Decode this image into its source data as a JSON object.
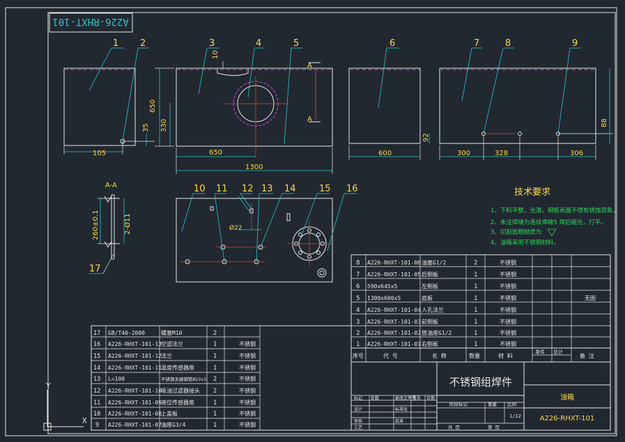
{
  "drawing_code_top": "A226-RHXT-101",
  "balloons": [
    "1",
    "2",
    "3",
    "4",
    "5",
    "6",
    "7",
    "8",
    "9",
    "10",
    "11",
    "12",
    "13",
    "14",
    "15",
    "16",
    "17"
  ],
  "dims": {
    "d10": "10",
    "d650v": "650",
    "d330": "330",
    "d35": "35",
    "d105": "105",
    "d650h": "650",
    "d1300": "1300",
    "d600": "600",
    "d92": "92",
    "d300": "300",
    "d328": "328",
    "d306": "306",
    "d88": "88",
    "d22": "Ø22",
    "d260": "260±0.1",
    "d2phi": "2-Ø11"
  },
  "section_marks": {
    "a_top": "A",
    "a_bot": "A",
    "aa": "A-A"
  },
  "tech": {
    "title": "技术要求",
    "items": [
      "1、下料平整，光滑，钢板表面不得有锈蚀现象。",
      "2、未注焊缝为连续焊缝5 焊后磨光，打平。",
      "3、切割面粗糙度为",
      "4、油箱采用不锈钢材料。"
    ]
  },
  "bom_right": [
    {
      "no": "8",
      "code": "A226-RHXT-101-06",
      "name": "油塞G1/2",
      "qty": "2",
      "mat": "不锈钢",
      "note": ""
    },
    {
      "no": "7",
      "code": "A226-RHXT-101-05",
      "name": "后侧板",
      "qty": "1",
      "mat": "不锈钢",
      "note": ""
    },
    {
      "no": "6",
      "code": "590x645x5",
      "name": "左侧板",
      "qty": "1",
      "mat": "不锈钢",
      "note": ""
    },
    {
      "no": "5",
      "code": "1300x600x5",
      "name": "底板",
      "qty": "1",
      "mat": "不锈钢",
      "note": "无图"
    },
    {
      "no": "4",
      "code": "A226-RHXT-101-04",
      "name": "人孔法兰",
      "qty": "1",
      "mat": "不锈钢",
      "note": ""
    },
    {
      "no": "3",
      "code": "A226-RHXT-101-03",
      "name": "前侧板",
      "qty": "1",
      "mat": "不锈钢",
      "note": ""
    },
    {
      "no": "2",
      "code": "A226-RHXT-101-02",
      "name": "放油座G1/2",
      "qty": "1",
      "mat": "不锈钢",
      "note": ""
    },
    {
      "no": "1",
      "code": "A226-RHXT-101-01",
      "name": "右侧板",
      "qty": "1",
      "mat": "不锈钢",
      "note": ""
    }
  ],
  "bom_header": {
    "no": "序号",
    "code": "代  号",
    "name": "名  称",
    "qty": "数量",
    "mat": "材  料",
    "w1": "单件",
    "w2": "总计",
    "note": "备  注"
  },
  "bom_left": [
    {
      "no": "17",
      "code": "GB/T40-2000",
      "name": "螺塞M10",
      "qty": "2",
      "mat": ""
    },
    {
      "no": "16",
      "code": "A226-RHXT-101-13",
      "name": "空滤法兰",
      "qty": "1",
      "mat": "不锈钢"
    },
    {
      "no": "15",
      "code": "A226-RHXT-101-12",
      "name": "法兰",
      "qty": "1",
      "mat": "不锈钢"
    },
    {
      "no": "14",
      "code": "A226-RHXT-101-11",
      "name": "温度传感器座",
      "qty": "1",
      "mat": "不锈钢"
    },
    {
      "no": "13",
      "code": "L=100",
      "name": "不锈钢无缝钢管Ø22x3",
      "qty": "2",
      "mat": "不锈钢"
    },
    {
      "no": "12",
      "code": "A226-RHXT-101-10",
      "name": "吸油过滤器接头",
      "qty": "2",
      "mat": "不锈钢"
    },
    {
      "no": "11",
      "code": "A226-RHXT-101-09",
      "name": "液位传感器座",
      "qty": "1",
      "mat": "不锈钢"
    },
    {
      "no": "10",
      "code": "A226-RHXT-101-08",
      "name": "上盖板",
      "qty": "1",
      "mat": "不锈钢"
    },
    {
      "no": "9",
      "code": "A226-RHXT-101-07",
      "name": "油座G3/4",
      "qty": "1",
      "mat": "不锈钢"
    }
  ],
  "title_block": {
    "part_name": "不锈钢组焊件",
    "product": "油箱",
    "drawing_no": "A226-RHXT-101",
    "scale": "1/12",
    "sheet_total": "共  页",
    "sheet_no": "第  页",
    "stage": "阶段标记",
    "weight": "重量",
    "ratio": "比例",
    "row_labels": [
      "标记",
      "设计",
      "审核",
      "工艺"
    ],
    "col_labels": [
      "处数",
      "更改文件号",
      "签名",
      "日期"
    ],
    "row_labels2": [
      "标准化",
      "批准"
    ]
  }
}
